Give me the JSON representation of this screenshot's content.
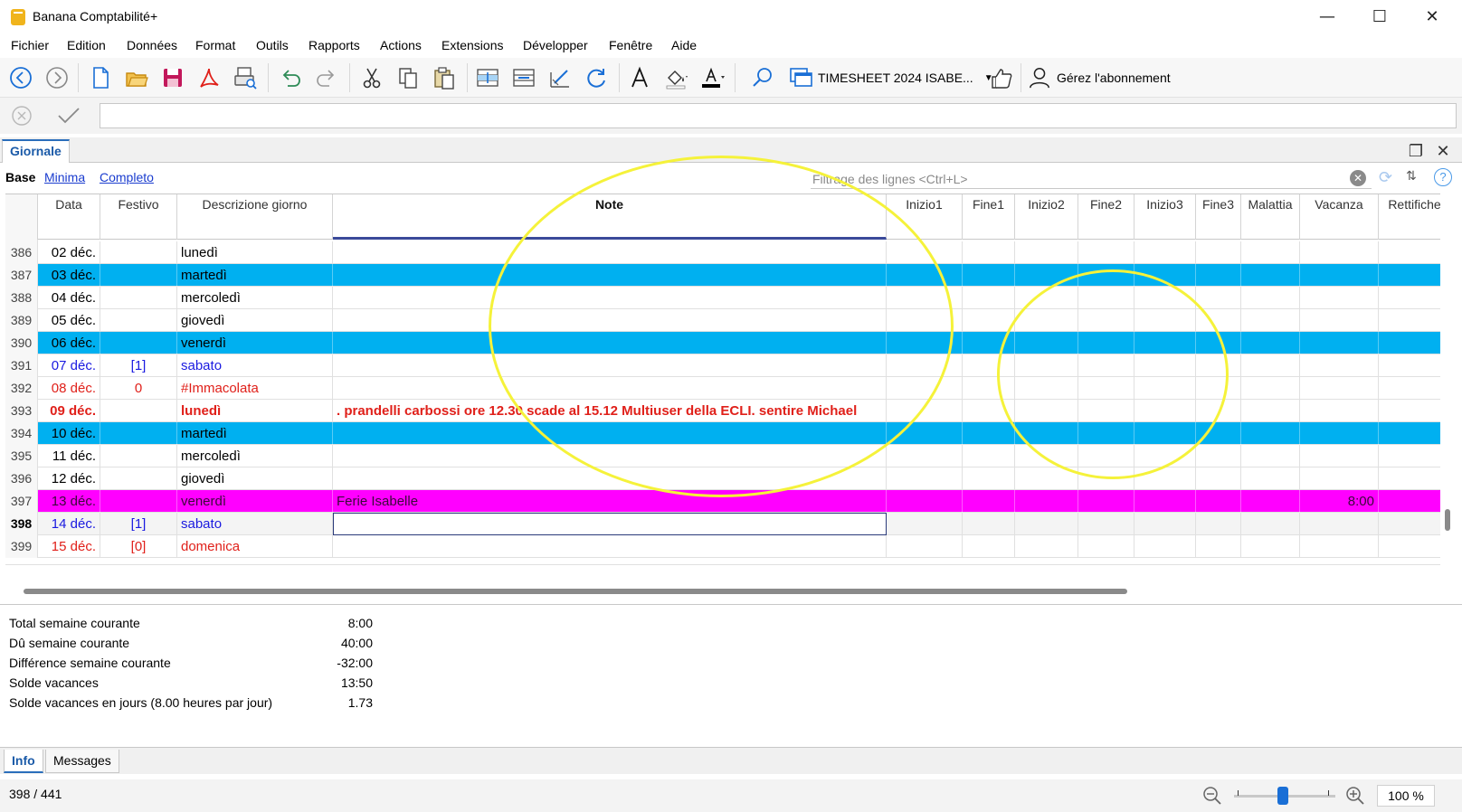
{
  "window": {
    "title": "Banana Comptabilité+",
    "minimize": "—",
    "maximize": "☐",
    "close": "✕"
  },
  "menu": [
    "Fichier",
    "Edition",
    "Données",
    "Format",
    "Outils",
    "Rapports",
    "Actions",
    "Extensions",
    "Développer",
    "Fenêtre",
    "Aide"
  ],
  "toolbar": {
    "file_name": "TIMESHEET 2024 ISABE...",
    "subscription": "Gérez l'abonnement"
  },
  "tabs": {
    "active": "Giornale"
  },
  "views": {
    "base": "Base",
    "minima": "Minima",
    "completo": "Completo"
  },
  "filter": {
    "placeholder": "Filtrage des lignes <Ctrl+L>"
  },
  "columns": {
    "data": "Data",
    "festivo": "Festivo",
    "descrizione": "Descrizione giorno",
    "note": "Note",
    "inizio1": "Inizio1",
    "fine1": "Fine1",
    "inizio2": "Inizio2",
    "fine2": "Fine2",
    "inizio3": "Inizio3",
    "fine3": "Fine3",
    "malattia": "Malattia",
    "vacanza": "Vacanza",
    "rettifiche": "Rettifiche"
  },
  "rows": [
    {
      "num": "386",
      "date": "02 déc.",
      "festivo": "",
      "desc": "lunedì",
      "note": "",
      "vacanza": "",
      "style": "normal"
    },
    {
      "num": "387",
      "date": "03 déc.",
      "festivo": "",
      "desc": "martedì",
      "note": "",
      "vacanza": "",
      "style": "cyan"
    },
    {
      "num": "388",
      "date": "04 déc.",
      "festivo": "",
      "desc": "mercoledì",
      "note": "",
      "vacanza": "",
      "style": "normal"
    },
    {
      "num": "389",
      "date": "05 déc.",
      "festivo": "",
      "desc": "giovedì",
      "note": "",
      "vacanza": "",
      "style": "normal"
    },
    {
      "num": "390",
      "date": "06 déc.",
      "festivo": "",
      "desc": "venerdì",
      "note": "",
      "vacanza": "",
      "style": "cyan"
    },
    {
      "num": "391",
      "date": "07 déc.",
      "festivo": "[1]",
      "desc": "sabato",
      "note": "",
      "vacanza": "",
      "style": "blue"
    },
    {
      "num": "392",
      "date": "08 déc.",
      "festivo": "0",
      "desc": "#Immacolata",
      "note": "",
      "vacanza": "",
      "style": "red"
    },
    {
      "num": "393",
      "date": "09 déc.",
      "festivo": "",
      "desc": "lunedì",
      "note": ". prandelli carbossi ore 12.30 scade al 15.12 Multiuser della ECLI. sentire Michael",
      "vacanza": "",
      "style": "bold-red"
    },
    {
      "num": "394",
      "date": "10 déc.",
      "festivo": "",
      "desc": "martedì",
      "note": "",
      "vacanza": "",
      "style": "cyan"
    },
    {
      "num": "395",
      "date": "11 déc.",
      "festivo": "",
      "desc": "mercoledì",
      "note": "",
      "vacanza": "",
      "style": "normal"
    },
    {
      "num": "396",
      "date": "12 déc.",
      "festivo": "",
      "desc": "giovedì",
      "note": "",
      "vacanza": "",
      "style": "normal"
    },
    {
      "num": "397",
      "date": "13 déc.",
      "festivo": "",
      "desc": "venerdì",
      "note": "Ferie Isabelle",
      "vacanza": "8:00",
      "style": "magenta"
    },
    {
      "num": "398",
      "date": "14 déc.",
      "festivo": "[1]",
      "desc": "sabato",
      "note": "",
      "vacanza": "",
      "style": "blue-selected"
    },
    {
      "num": "399",
      "date": "15 déc.",
      "festivo": "[0]",
      "desc": "domenica",
      "note": "",
      "vacanza": "",
      "style": "red"
    }
  ],
  "info": [
    {
      "label": "Total semaine courante",
      "value": "8:00"
    },
    {
      "label": "Dû semaine courante",
      "value": "40:00"
    },
    {
      "label": "Différence semaine courante",
      "value": "-32:00"
    },
    {
      "label": "Solde vacances",
      "value": "13:50"
    },
    {
      "label": "Solde vacances en jours (8.00 heures par jour)",
      "value": "1.73"
    }
  ],
  "bottom_tabs": {
    "info": "Info",
    "messages": "Messages"
  },
  "status": {
    "position": "398 / 441",
    "zoom": "100 %"
  },
  "colors": {
    "cyan_row": "#00b0f0",
    "magenta_row": "#ff00ff",
    "red_text": "#e0201a",
    "blue_text": "#1a1ae0",
    "highlight_ellipse": "#f5f23a"
  },
  "icons": [
    "back-icon",
    "forward-icon",
    "new-file-icon",
    "open-folder-icon",
    "save-icon",
    "pdf-icon",
    "print-preview-icon",
    "undo-icon",
    "redo-icon",
    "cut-icon",
    "copy-icon",
    "paste-icon",
    "insert-row-icon",
    "delete-row-icon",
    "edit-row-icon",
    "recalculate-icon",
    "font-icon",
    "fill-color-icon",
    "text-color-icon",
    "search-icon",
    "window-list-icon",
    "thumbs-up-icon",
    "user-icon"
  ]
}
